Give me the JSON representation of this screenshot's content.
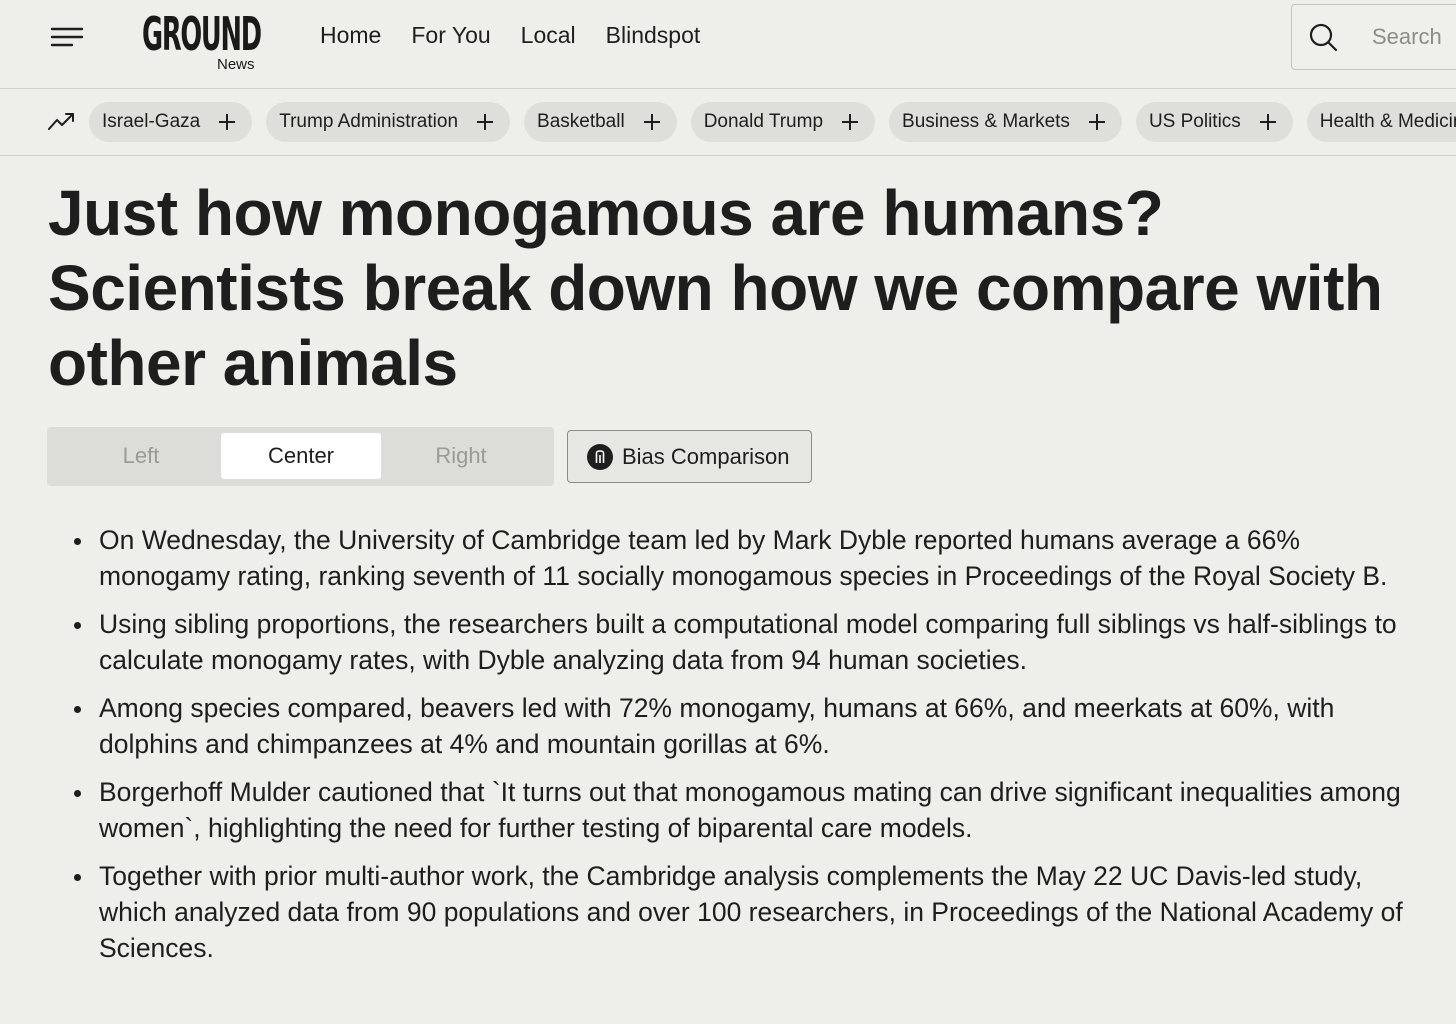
{
  "header": {
    "logo_text": "GROUND",
    "logo_sub": "News",
    "nav": [
      "Home",
      "For You",
      "Local",
      "Blindspot"
    ],
    "search_placeholder": "Search"
  },
  "topics": {
    "icon": "trending-icon",
    "chips": [
      "Israel-Gaza",
      "Trump Administration",
      "Basketball",
      "Donald Trump",
      "Business & Markets",
      "US Politics",
      "Health & Medicine"
    ]
  },
  "article": {
    "title": "Just how monogamous are humans? Scientists break down how we compare with other animals",
    "bias_tabs": {
      "left": "Left",
      "center": "Center",
      "right": "Right",
      "selected": "Center"
    },
    "bias_comparison_label": "Bias Comparison",
    "summary": [
      "On Wednesday, the University of Cambridge team led by Mark Dyble reported humans average a 66% monogamy rating, ranking seventh of 11 socially monogamous species in Proceedings of the Royal Society B.",
      "Using sibling proportions, the researchers built a computational model comparing full siblings vs half-siblings to calculate monogamy rates, with Dyble analyzing data from 94 human societies.",
      "Among species compared, beavers led with 72% monogamy, humans at 66%, and meerkats at 60%, with dolphins and chimpanzees at 4% and mountain gorillas at 6%.",
      "Borgerhoff Mulder cautioned that `It turns out that monogamous mating can drive significant inequalities among women`, highlighting the need for further testing of biparental care models.",
      "Together with prior multi-author work, the Cambridge analysis complements the May 22 UC Davis-led study, which analyzed data from 90 populations and over 100 researchers, in Proceedings of the National Academy of Sciences."
    ]
  },
  "colors": {
    "background": "#eeeeea",
    "chip_bg": "#dededa",
    "text": "#1e1e1e",
    "muted": "#9a9a96"
  }
}
